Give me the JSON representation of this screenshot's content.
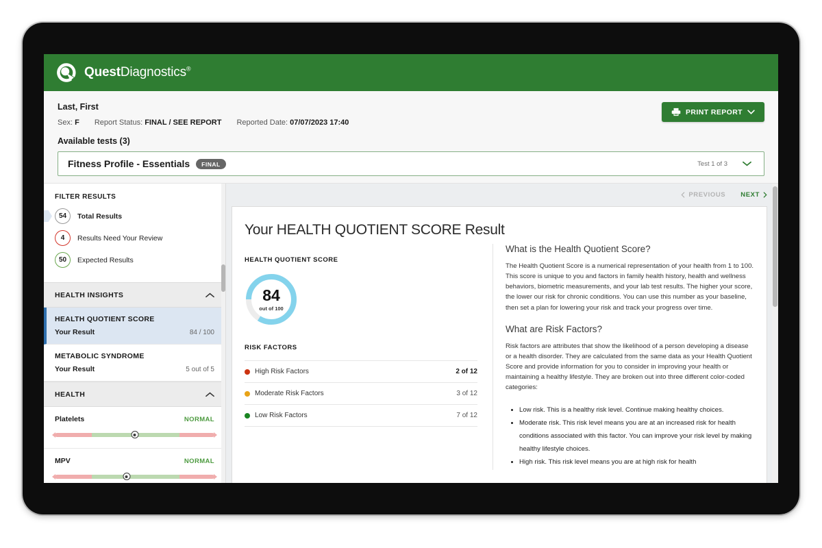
{
  "brand": {
    "name_bold": "Quest",
    "name_light": "Diagnostics",
    "registered_mark": "®",
    "logo_icon": "quest-logo-icon",
    "bar_color": "#2f7d32"
  },
  "patient_header": {
    "name": "Last, First",
    "sex_label": "Sex:",
    "sex_value": "F",
    "report_status_label": "Report Status:",
    "report_status_value": "FINAL / SEE REPORT",
    "reported_date_label": "Reported Date:",
    "reported_date_value": "07/07/2023 17:40",
    "available_tests_label": "Available tests (3)",
    "print_button_label": "PRINT REPORT",
    "print_icon": "printer-icon",
    "print_chevron_icon": "chevron-down-icon"
  },
  "test_selector": {
    "name": "Fitness Profile - Essentials",
    "status_badge": "FINAL",
    "counter": "Test 1 of 3",
    "chevron_icon": "chevron-down-icon"
  },
  "sidebar": {
    "filter_title": "FILTER RESULTS",
    "filters": [
      {
        "count": "54",
        "label": "Total Results",
        "style": "total",
        "active": true
      },
      {
        "count": "4",
        "label": "Results Need Your Review",
        "style": "review",
        "active": false
      },
      {
        "count": "50",
        "label": "Expected Results",
        "style": "expected",
        "active": false
      }
    ],
    "sections": [
      {
        "title": "HEALTH INSIGHTS",
        "chevron_icon": "chevron-up-icon"
      },
      {
        "title": "HEALTH",
        "chevron_icon": "chevron-up-icon"
      }
    ],
    "insights": [
      {
        "title": "HEALTH QUOTIENT SCORE",
        "row_label": "Your Result",
        "row_value": "84 / 100",
        "selected": true
      },
      {
        "title": "METABOLIC SYNDROME",
        "row_label": "Your Result",
        "row_value": "5 out of 5",
        "selected": false
      }
    ],
    "analytes": [
      {
        "name": "Platelets",
        "status": "NORMAL",
        "marker_pct": 50
      },
      {
        "name": "MPV",
        "status": "NORMAL",
        "marker_pct": 45
      }
    ],
    "scrollbar": "sidebar-scrollbar"
  },
  "main": {
    "pager": {
      "previous_label": "PREVIOUS",
      "next_label": "NEXT",
      "previous_icon": "chevron-left-icon",
      "next_icon": "chevron-right-icon"
    },
    "result_title": "Your HEALTH QUOTIENT SCORE Result",
    "score_section_title": "HEALTH QUOTIENT SCORE",
    "risk_section_title": "RISK FACTORS",
    "info": {
      "heading_1": "What is the Health Quotient Score?",
      "para_1": "The Health Quotient Score is a numerical representation of your health from 1 to 100. This score is unique to you and factors in family health history, health and wellness behaviors, biometric measurements, and your lab test results. The higher your score, the lower our risk for chronic conditions. You can use this number as your baseline, then set a plan for lowering your risk and track your progress over time.",
      "heading_2": "What are Risk Factors?",
      "para_2": "Risk factors are attributes that show the likelihood of a person developing a disease or a health disorder. They are calculated from the same data as your Health Quotient Score and provide information for you to consider in improving your health or maintaining a healthy lifestyle. They are broken out into three different color-coded categories:",
      "bullets": [
        "Low risk. This is a healthy risk level. Continue making healthy choices.",
        "Moderate risk. This risk level means you are at an increased risk for health conditions associated with this factor. You can improve your risk level by making healthy lifestyle choices.",
        "High risk. This risk level means you are at high risk for health"
      ]
    }
  },
  "chart_data": {
    "type": "pie",
    "title": "HEALTH QUOTIENT SCORE",
    "gauge": {
      "value": 84,
      "max": 100,
      "value_text": "84",
      "denominator_text": "out of 100",
      "arc_color": "#84d3ec",
      "track_color": "#ececec",
      "percent_filled": 84
    },
    "risk_factors": {
      "title": "RISK FACTORS",
      "total": 12,
      "categories": [
        "High Risk Factors",
        "Moderate Risk Factors",
        "Low Risk Factors"
      ],
      "values": [
        2,
        3,
        7
      ],
      "value_texts": [
        "2 of 12",
        "3 of 12",
        "7 of 12"
      ],
      "colors": [
        "#cc3311",
        "#e8a317",
        "#1a8522"
      ]
    }
  }
}
